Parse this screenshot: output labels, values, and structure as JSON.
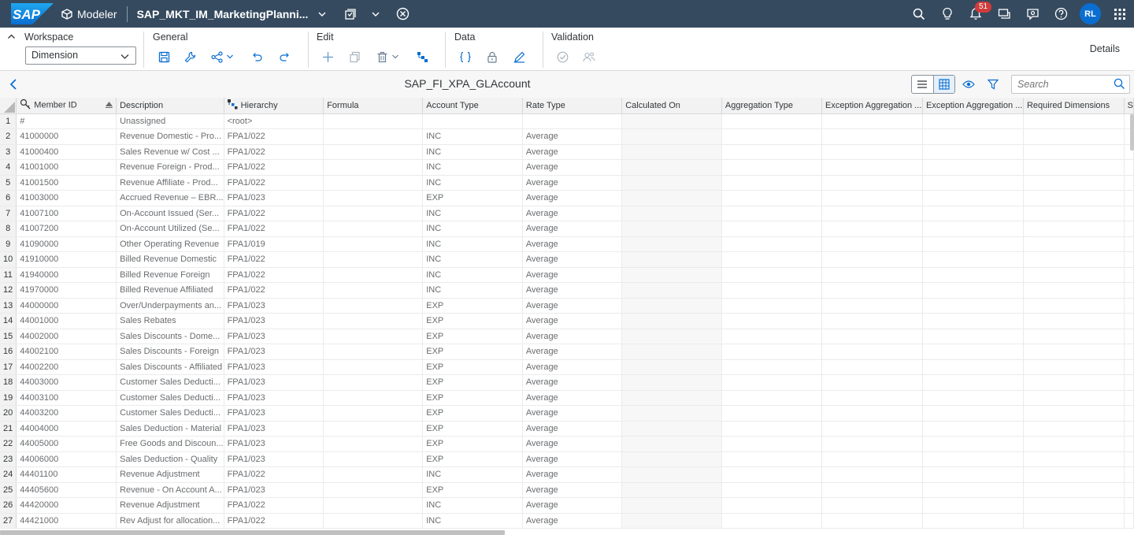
{
  "shell": {
    "logo": "SAP",
    "app_label": "Modeler",
    "title": "SAP_MKT_IM_MarketingPlanni...",
    "notification_count": "51",
    "user_initials": "RL"
  },
  "toolbar": {
    "workspace_title": "Workspace",
    "workspace_value": "Dimension",
    "general_title": "General",
    "edit_title": "Edit",
    "data_title": "Data",
    "validation_title": "Validation",
    "details_label": "Details"
  },
  "titlebar": {
    "title": "SAP_FI_XPA_GLAccount",
    "search_placeholder": "Search"
  },
  "grid": {
    "columns": [
      "Member ID",
      "Description",
      "Hierarchy",
      "Formula",
      "Account Type",
      "Rate Type",
      "Calculated On",
      "Aggregation Type",
      "Exception Aggregation ...",
      "Exception Aggregation ...",
      "Required Dimensions",
      "S"
    ],
    "rows": [
      [
        "1",
        "#",
        "Unassigned",
        "<root>",
        "",
        "",
        ""
      ],
      [
        "2",
        "41000000",
        "Revenue Domestic - Pro...",
        "FPA1/022",
        "",
        "INC",
        "Average"
      ],
      [
        "3",
        "41000400",
        "Sales Revenue w/ Cost ...",
        "FPA1/022",
        "",
        "INC",
        "Average"
      ],
      [
        "4",
        "41001000",
        "Revenue Foreign - Prod...",
        "FPA1/022",
        "",
        "INC",
        "Average"
      ],
      [
        "5",
        "41001500",
        "Revenue Affiliate - Prod...",
        "FPA1/022",
        "",
        "INC",
        "Average"
      ],
      [
        "6",
        "41003000",
        "Accrued Revenue – EBR...",
        "FPA1/023",
        "",
        "EXP",
        "Average"
      ],
      [
        "7",
        "41007100",
        "On-Account Issued (Ser...",
        "FPA1/022",
        "",
        "INC",
        "Average"
      ],
      [
        "8",
        "41007200",
        "On-Account Utilized (Se...",
        "FPA1/022",
        "",
        "INC",
        "Average"
      ],
      [
        "9",
        "41090000",
        "Other Operating Revenue",
        "FPA1/019",
        "",
        "INC",
        "Average"
      ],
      [
        "10",
        "41910000",
        "Billed Revenue Domestic",
        "FPA1/022",
        "",
        "INC",
        "Average"
      ],
      [
        "11",
        "41940000",
        "Billed Revenue Foreign",
        "FPA1/022",
        "",
        "INC",
        "Average"
      ],
      [
        "12",
        "41970000",
        "Billed Revenue Affiliated",
        "FPA1/022",
        "",
        "INC",
        "Average"
      ],
      [
        "13",
        "44000000",
        "Over/Underpayments an...",
        "FPA1/023",
        "",
        "EXP",
        "Average"
      ],
      [
        "14",
        "44001000",
        "Sales Rebates",
        "FPA1/023",
        "",
        "EXP",
        "Average"
      ],
      [
        "15",
        "44002000",
        "Sales Discounts - Dome...",
        "FPA1/023",
        "",
        "EXP",
        "Average"
      ],
      [
        "16",
        "44002100",
        "Sales Discounts - Foreign",
        "FPA1/023",
        "",
        "EXP",
        "Average"
      ],
      [
        "17",
        "44002200",
        "Sales Discounts - Affiliated",
        "FPA1/023",
        "",
        "EXP",
        "Average"
      ],
      [
        "18",
        "44003000",
        "Customer Sales Deducti...",
        "FPA1/023",
        "",
        "EXP",
        "Average"
      ],
      [
        "19",
        "44003100",
        "Customer Sales Deducti...",
        "FPA1/023",
        "",
        "EXP",
        "Average"
      ],
      [
        "20",
        "44003200",
        "Customer Sales Deducti...",
        "FPA1/023",
        "",
        "EXP",
        "Average"
      ],
      [
        "21",
        "44004000",
        "Sales Deduction - Material",
        "FPA1/023",
        "",
        "EXP",
        "Average"
      ],
      [
        "22",
        "44005000",
        "Free Goods and Discoun...",
        "FPA1/023",
        "",
        "EXP",
        "Average"
      ],
      [
        "23",
        "44006000",
        "Sales Deduction - Quality",
        "FPA1/023",
        "",
        "EXP",
        "Average"
      ],
      [
        "24",
        "44401100",
        "Revenue Adjustment",
        "FPA1/022",
        "",
        "INC",
        "Average"
      ],
      [
        "25",
        "44405600",
        "Revenue - On Account A...",
        "FPA1/023",
        "",
        "EXP",
        "Average"
      ],
      [
        "26",
        "44420000",
        "Revenue Adjustment",
        "FPA1/022",
        "",
        "INC",
        "Average"
      ],
      [
        "27",
        "44421000",
        "Rev Adjust for allocation...",
        "FPA1/022",
        "",
        "INC",
        "Average"
      ]
    ]
  },
  "colors": {
    "shell_bg": "#354a5f",
    "accent": "#0a6ed1",
    "badge": "#d03b3b"
  }
}
